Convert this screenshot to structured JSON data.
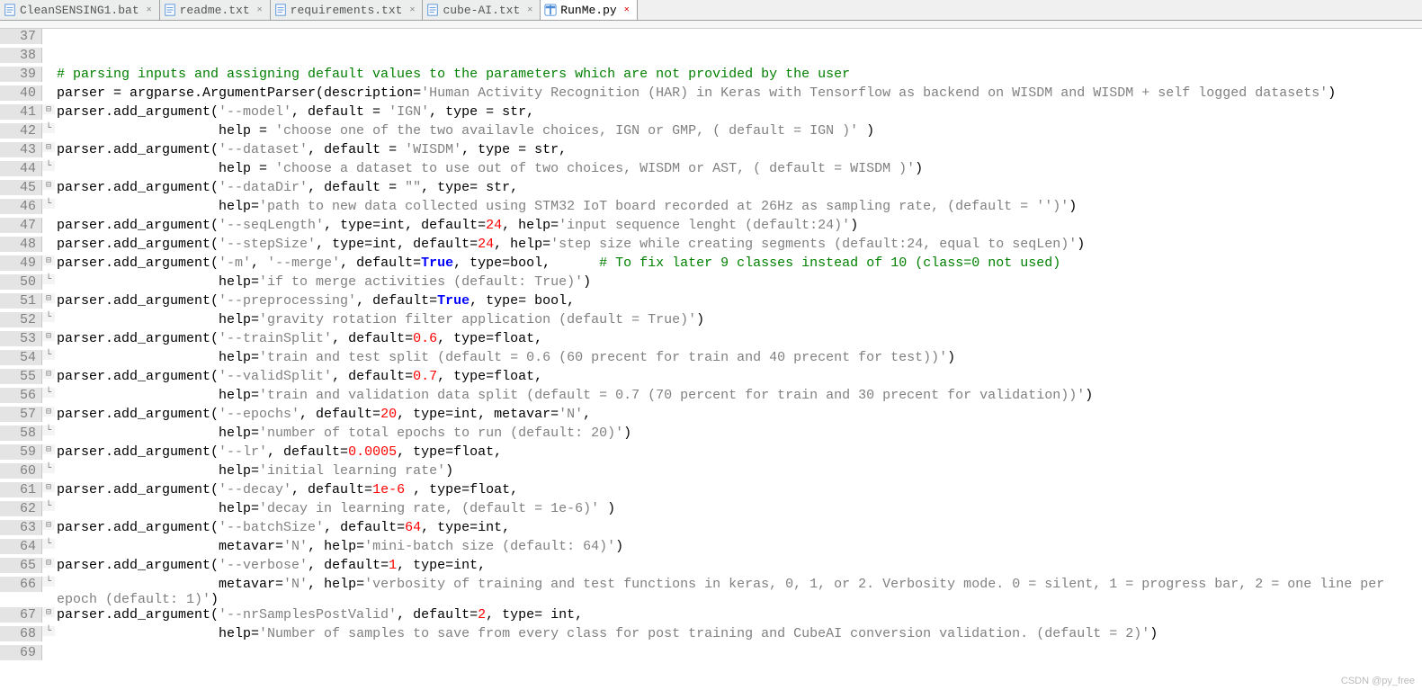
{
  "tabs": [
    {
      "label": "CleanSENSING1.bat",
      "icon": "bat",
      "active": false
    },
    {
      "label": "readme.txt",
      "icon": "txt",
      "active": false
    },
    {
      "label": "requirements.txt",
      "icon": "txt",
      "active": false
    },
    {
      "label": "cube-AI.txt",
      "icon": "txt",
      "active": false
    },
    {
      "label": "RunMe.py",
      "icon": "py",
      "active": true
    }
  ],
  "watermark": "CSDN @py_free",
  "code_lines": [
    {
      "n": 37,
      "fold": "",
      "tokens": []
    },
    {
      "n": 38,
      "fold": "",
      "tokens": []
    },
    {
      "n": 39,
      "fold": "",
      "tokens": [
        {
          "c": "cmt",
          "t": "# parsing inputs and assigning default values to the parameters which are not provided by the user"
        }
      ]
    },
    {
      "n": 40,
      "fold": "",
      "tokens": [
        {
          "c": "id",
          "t": "parser = argparse.ArgumentParser(description="
        },
        {
          "c": "str",
          "t": "'Human Activity Recognition (HAR) in Keras with Tensorflow as backend on WISDM and WISDM + self logged datasets'"
        },
        {
          "c": "id",
          "t": ")"
        }
      ],
      "wrap": true
    },
    {
      "n": 41,
      "fold": "⊟",
      "tokens": [
        {
          "c": "id",
          "t": "parser.add_argument("
        },
        {
          "c": "str",
          "t": "'--model'"
        },
        {
          "c": "id",
          "t": ", default = "
        },
        {
          "c": "str",
          "t": "'IGN'"
        },
        {
          "c": "id",
          "t": ", type = str,"
        }
      ]
    },
    {
      "n": 42,
      "fold": "└",
      "tokens": [
        {
          "c": "id",
          "t": "                    help = "
        },
        {
          "c": "str",
          "t": "'choose one of the two availavle choices, IGN or GMP, ( default = IGN )'"
        },
        {
          "c": "id",
          "t": " )"
        }
      ]
    },
    {
      "n": 43,
      "fold": "⊟",
      "tokens": [
        {
          "c": "id",
          "t": "parser.add_argument("
        },
        {
          "c": "str",
          "t": "'--dataset'"
        },
        {
          "c": "id",
          "t": ", default = "
        },
        {
          "c": "str",
          "t": "'WISDM'"
        },
        {
          "c": "id",
          "t": ", type = str,"
        }
      ]
    },
    {
      "n": 44,
      "fold": "└",
      "tokens": [
        {
          "c": "id",
          "t": "                    help = "
        },
        {
          "c": "str",
          "t": "'choose a dataset to use out of two choices, WISDM or AST, ( default = WISDM )'"
        },
        {
          "c": "id",
          "t": ")"
        }
      ]
    },
    {
      "n": 45,
      "fold": "⊟",
      "tokens": [
        {
          "c": "id",
          "t": "parser.add_argument("
        },
        {
          "c": "str",
          "t": "'--dataDir'"
        },
        {
          "c": "id",
          "t": ", default = "
        },
        {
          "c": "str",
          "t": "\"\""
        },
        {
          "c": "id",
          "t": ", type= str,"
        }
      ]
    },
    {
      "n": 46,
      "fold": "└",
      "tokens": [
        {
          "c": "id",
          "t": "                    help="
        },
        {
          "c": "str",
          "t": "'path to new data collected using STM32 IoT board recorded at 26Hz as sampling rate, (default = '')'"
        },
        {
          "c": "id",
          "t": ")"
        }
      ]
    },
    {
      "n": 47,
      "fold": "",
      "tokens": [
        {
          "c": "id",
          "t": "parser.add_argument("
        },
        {
          "c": "str",
          "t": "'--seqLength'"
        },
        {
          "c": "id",
          "t": ", type=int, default="
        },
        {
          "c": "num",
          "t": "24"
        },
        {
          "c": "id",
          "t": ", help="
        },
        {
          "c": "str",
          "t": "'input sequence lenght (default:24)'"
        },
        {
          "c": "id",
          "t": ")"
        }
      ]
    },
    {
      "n": 48,
      "fold": "",
      "tokens": [
        {
          "c": "id",
          "t": "parser.add_argument("
        },
        {
          "c": "str",
          "t": "'--stepSize'"
        },
        {
          "c": "id",
          "t": ", type=int, default="
        },
        {
          "c": "num",
          "t": "24"
        },
        {
          "c": "id",
          "t": ", help="
        },
        {
          "c": "str",
          "t": "'step size while creating segments (default:24, equal to seqLen)'"
        },
        {
          "c": "id",
          "t": ")"
        }
      ]
    },
    {
      "n": 49,
      "fold": "⊟",
      "tokens": [
        {
          "c": "id",
          "t": "parser.add_argument("
        },
        {
          "c": "str",
          "t": "'-m'"
        },
        {
          "c": "id",
          "t": ", "
        },
        {
          "c": "str",
          "t": "'--merge'"
        },
        {
          "c": "id",
          "t": ", default="
        },
        {
          "c": "kw",
          "t": "True"
        },
        {
          "c": "id",
          "t": ", type=bool,      "
        },
        {
          "c": "cmt",
          "t": "# To fix later 9 classes instead of 10 (class=0 not used)"
        }
      ]
    },
    {
      "n": 50,
      "fold": "└",
      "tokens": [
        {
          "c": "id",
          "t": "                    help="
        },
        {
          "c": "str",
          "t": "'if to merge activities (default: True)'"
        },
        {
          "c": "id",
          "t": ")"
        }
      ]
    },
    {
      "n": 51,
      "fold": "⊟",
      "tokens": [
        {
          "c": "id",
          "t": "parser.add_argument("
        },
        {
          "c": "str",
          "t": "'--preprocessing'"
        },
        {
          "c": "id",
          "t": ", default="
        },
        {
          "c": "kw",
          "t": "True"
        },
        {
          "c": "id",
          "t": ", type= bool,"
        }
      ]
    },
    {
      "n": 52,
      "fold": "└",
      "tokens": [
        {
          "c": "id",
          "t": "                    help="
        },
        {
          "c": "str",
          "t": "'gravity rotation filter application (default = True)'"
        },
        {
          "c": "id",
          "t": ")"
        }
      ]
    },
    {
      "n": 53,
      "fold": "⊟",
      "tokens": [
        {
          "c": "id",
          "t": "parser.add_argument("
        },
        {
          "c": "str",
          "t": "'--trainSplit'"
        },
        {
          "c": "id",
          "t": ", default="
        },
        {
          "c": "num",
          "t": "0.6"
        },
        {
          "c": "id",
          "t": ", type=float,"
        }
      ]
    },
    {
      "n": 54,
      "fold": "└",
      "tokens": [
        {
          "c": "id",
          "t": "                    help="
        },
        {
          "c": "str",
          "t": "'train and test split (default = 0.6 (60 precent for train and 40 precent for test))'"
        },
        {
          "c": "id",
          "t": ")"
        }
      ]
    },
    {
      "n": 55,
      "fold": "⊟",
      "tokens": [
        {
          "c": "id",
          "t": "parser.add_argument("
        },
        {
          "c": "str",
          "t": "'--validSplit'"
        },
        {
          "c": "id",
          "t": ", default="
        },
        {
          "c": "num",
          "t": "0.7"
        },
        {
          "c": "id",
          "t": ", type=float,"
        }
      ]
    },
    {
      "n": 56,
      "fold": "└",
      "tokens": [
        {
          "c": "id",
          "t": "                    help="
        },
        {
          "c": "str",
          "t": "'train and validation data split (default = 0.7 (70 percent for train and 30 precent for validation))'"
        },
        {
          "c": "id",
          "t": ")"
        }
      ]
    },
    {
      "n": 57,
      "fold": "⊟",
      "tokens": [
        {
          "c": "id",
          "t": "parser.add_argument("
        },
        {
          "c": "str",
          "t": "'--epochs'"
        },
        {
          "c": "id",
          "t": ", default="
        },
        {
          "c": "num",
          "t": "20"
        },
        {
          "c": "id",
          "t": ", type=int, metavar="
        },
        {
          "c": "str",
          "t": "'N'"
        },
        {
          "c": "id",
          "t": ","
        }
      ]
    },
    {
      "n": 58,
      "fold": "└",
      "tokens": [
        {
          "c": "id",
          "t": "                    help="
        },
        {
          "c": "str",
          "t": "'number of total epochs to run (default: 20)'"
        },
        {
          "c": "id",
          "t": ")"
        }
      ]
    },
    {
      "n": 59,
      "fold": "⊟",
      "tokens": [
        {
          "c": "id",
          "t": "parser.add_argument("
        },
        {
          "c": "str",
          "t": "'--lr'"
        },
        {
          "c": "id",
          "t": ", default="
        },
        {
          "c": "num",
          "t": "0.0005"
        },
        {
          "c": "id",
          "t": ", type=float,"
        }
      ]
    },
    {
      "n": 60,
      "fold": "└",
      "tokens": [
        {
          "c": "id",
          "t": "                    help="
        },
        {
          "c": "str",
          "t": "'initial learning rate'"
        },
        {
          "c": "id",
          "t": ")"
        }
      ]
    },
    {
      "n": 61,
      "fold": "⊟",
      "tokens": [
        {
          "c": "id",
          "t": "parser.add_argument("
        },
        {
          "c": "str",
          "t": "'--decay'"
        },
        {
          "c": "id",
          "t": ", default="
        },
        {
          "c": "num",
          "t": "1e-6"
        },
        {
          "c": "id",
          "t": " , type=float,"
        }
      ]
    },
    {
      "n": 62,
      "fold": "└",
      "tokens": [
        {
          "c": "id",
          "t": "                    help="
        },
        {
          "c": "str",
          "t": "'decay in learning rate, (default = 1e-6)'"
        },
        {
          "c": "id",
          "t": " )"
        }
      ]
    },
    {
      "n": 63,
      "fold": "⊟",
      "tokens": [
        {
          "c": "id",
          "t": "parser.add_argument("
        },
        {
          "c": "str",
          "t": "'--batchSize'"
        },
        {
          "c": "id",
          "t": ", default="
        },
        {
          "c": "num",
          "t": "64"
        },
        {
          "c": "id",
          "t": ", type=int,"
        }
      ]
    },
    {
      "n": 64,
      "fold": "└",
      "tokens": [
        {
          "c": "id",
          "t": "                    metavar="
        },
        {
          "c": "str",
          "t": "'N'"
        },
        {
          "c": "id",
          "t": ", help="
        },
        {
          "c": "str",
          "t": "'mini-batch size (default: 64)'"
        },
        {
          "c": "id",
          "t": ")"
        }
      ]
    },
    {
      "n": 65,
      "fold": "⊟",
      "tokens": [
        {
          "c": "id",
          "t": "parser.add_argument("
        },
        {
          "c": "str",
          "t": "'--verbose'"
        },
        {
          "c": "id",
          "t": ", default="
        },
        {
          "c": "num",
          "t": "1"
        },
        {
          "c": "id",
          "t": ", type=int,"
        }
      ]
    },
    {
      "n": 66,
      "fold": "└",
      "tokens": [
        {
          "c": "id",
          "t": "                    metavar="
        },
        {
          "c": "str",
          "t": "'N'"
        },
        {
          "c": "id",
          "t": ", help="
        },
        {
          "c": "str",
          "t": "'verbosity of training and test functions in keras, 0, 1, or 2. Verbosity mode. 0 = silent, 1 = progress bar, 2 = one line per epoch (default: 1)'"
        },
        {
          "c": "id",
          "t": ")"
        }
      ],
      "wrap": true
    },
    {
      "n": 67,
      "fold": "⊟",
      "tokens": [
        {
          "c": "id",
          "t": "parser.add_argument("
        },
        {
          "c": "str",
          "t": "'--nrSamplesPostValid'"
        },
        {
          "c": "id",
          "t": ", default="
        },
        {
          "c": "num",
          "t": "2"
        },
        {
          "c": "id",
          "t": ", type= int,"
        }
      ]
    },
    {
      "n": 68,
      "fold": "└",
      "tokens": [
        {
          "c": "id",
          "t": "                    help="
        },
        {
          "c": "str",
          "t": "'Number of samples to save from every class for post training and CubeAI conversion validation. (default = 2)'"
        },
        {
          "c": "id",
          "t": ")"
        }
      ]
    },
    {
      "n": 69,
      "fold": "",
      "tokens": []
    }
  ]
}
